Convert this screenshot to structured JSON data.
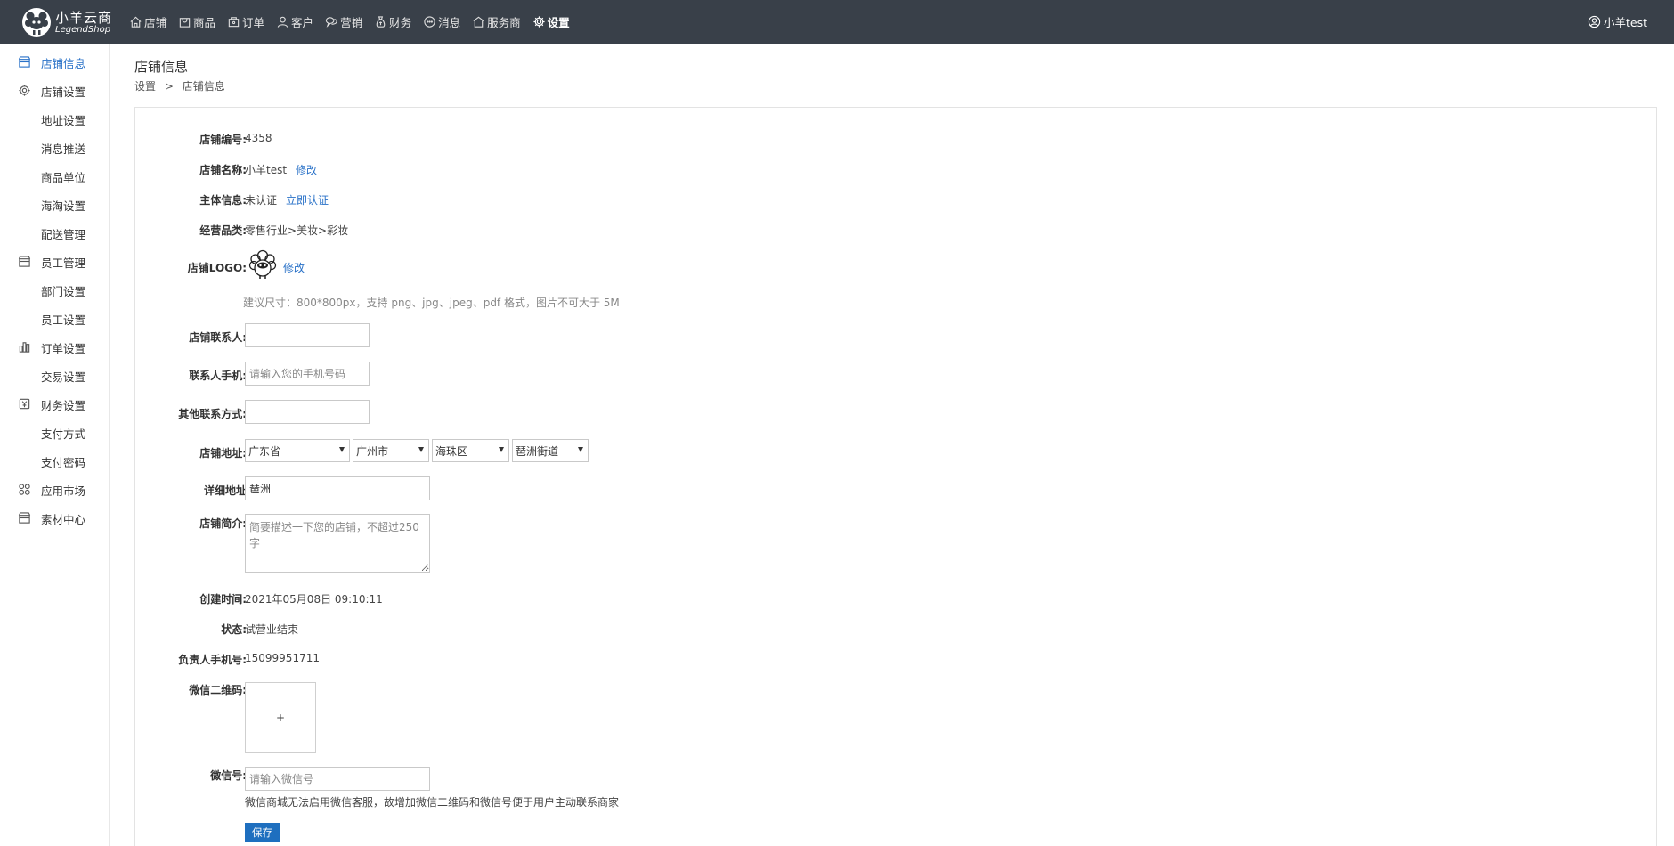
{
  "brand": {
    "name_cn": "小羊云商",
    "name_en": "LegendShop"
  },
  "topnav": [
    {
      "label": "店铺",
      "icon": "home-icon"
    },
    {
      "label": "商品",
      "icon": "bag-icon"
    },
    {
      "label": "订单",
      "icon": "cart-icon"
    },
    {
      "label": "客户",
      "icon": "user-icon"
    },
    {
      "label": "营销",
      "icon": "chat-icon"
    },
    {
      "label": "财务",
      "icon": "money-bag-icon"
    },
    {
      "label": "消息",
      "icon": "message-icon"
    },
    {
      "label": "服务商",
      "icon": "store-icon"
    },
    {
      "label": "设置",
      "icon": "gear-icon",
      "active": true
    }
  ],
  "user": {
    "name": "小羊test"
  },
  "sidebar": {
    "items": [
      {
        "label": "店铺信息",
        "icon": "store-icon",
        "active": true
      },
      {
        "label": "店铺设置",
        "icon": "gear-icon"
      },
      {
        "label": "地址设置"
      },
      {
        "label": "消息推送"
      },
      {
        "label": "商品单位"
      },
      {
        "label": "海淘设置"
      },
      {
        "label": "配送管理"
      },
      {
        "label": "员工管理",
        "icon": "store-icon"
      },
      {
        "label": "部门设置"
      },
      {
        "label": "员工设置"
      },
      {
        "label": "订单设置",
        "icon": "chart-icon"
      },
      {
        "label": "交易设置"
      },
      {
        "label": "财务设置",
        "icon": "yen-icon"
      },
      {
        "label": "支付方式"
      },
      {
        "label": "支付密码"
      },
      {
        "label": "应用市场",
        "icon": "apps-icon"
      },
      {
        "label": "素材中心",
        "icon": "store-icon"
      }
    ]
  },
  "page": {
    "title": "店铺信息",
    "breadcrumb": [
      "设置",
      "店铺信息"
    ],
    "breadcrumb_sep": ">"
  },
  "form": {
    "shop_id": {
      "label": "店铺编号:",
      "value": "4358"
    },
    "shop_name": {
      "label": "店铺名称:",
      "value": "小羊test",
      "action": "修改"
    },
    "entity": {
      "label": "主体信息:",
      "value": "未认证",
      "action": "立即认证"
    },
    "category": {
      "label": "经营品类:",
      "value": "零售行业>美妆>彩妆"
    },
    "logo": {
      "label": "店铺LOGO:",
      "action": "修改",
      "hint": "建议尺寸：800*800px，支持 png、jpg、jpeg、pdf 格式，图片不可大于 5M"
    },
    "contact": {
      "label": "店铺联系人:",
      "value": "",
      "placeholder": ""
    },
    "phone": {
      "label": "联系人手机:",
      "value": "",
      "placeholder": "请输入您的手机号码"
    },
    "other_contact": {
      "label": "其他联系方式:",
      "value": "",
      "placeholder": ""
    },
    "address": {
      "label": "店铺地址:",
      "province": "广东省",
      "city": "广州市",
      "district": "海珠区",
      "street": "琶洲街道"
    },
    "detail_address": {
      "label": "详细地址",
      "value": "琶洲",
      "placeholder": ""
    },
    "intro": {
      "label": "店铺简介:",
      "value": "",
      "placeholder": "简要描述一下您的店铺，不超过250字"
    },
    "created": {
      "label": "创建时间:",
      "value": "2021年05月08日 09:10:11"
    },
    "status": {
      "label": "状态:",
      "value": "试营业结束"
    },
    "owner_phone": {
      "label": "负责人手机号:",
      "value": "15099951711"
    },
    "wechat_qr": {
      "label": "微信二维码:",
      "plus": "+"
    },
    "wechat_id": {
      "label": "微信号:",
      "value": "",
      "placeholder": "请输入微信号",
      "hint": "微信商城无法启用微信客服，故增加微信二维码和微信号便于用户主动联系商家"
    },
    "save_label": "保存"
  }
}
